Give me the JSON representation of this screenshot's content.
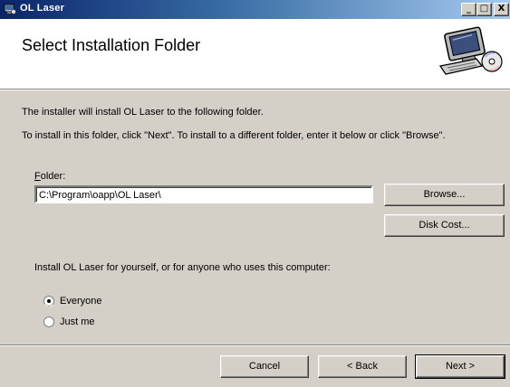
{
  "window": {
    "title": "OL Laser",
    "minimize_glyph": "_",
    "maximize_glyph": "□",
    "close_glyph": "X"
  },
  "header": {
    "title": "Select Installation Folder",
    "graphic_icon": "computer-install-icon"
  },
  "body": {
    "line1": "The installer will install OL Laser to the following folder.",
    "line2": "To install in this folder, click \"Next\". To install to a different folder, enter it below or click \"Browse\".",
    "folder_label_accel": "F",
    "folder_label_rest": "older:",
    "folder_value": "C:\\Program\\oapp\\OL Laser\\",
    "browse_label": "Browse...",
    "disk_cost_label": "Disk Cost...",
    "install_for_label": "Install OL Laser for yourself, or for anyone who uses this computer:",
    "options": [
      {
        "label": "Everyone",
        "selected": true
      },
      {
        "label": "Just me",
        "selected": false
      }
    ]
  },
  "footer": {
    "cancel_label": "Cancel",
    "back_label": "< Back",
    "next_label": "Next >"
  },
  "colors": {
    "titlebar_start": "#0a246a",
    "titlebar_end": "#a6caf0",
    "face": "#d4d0c8"
  }
}
